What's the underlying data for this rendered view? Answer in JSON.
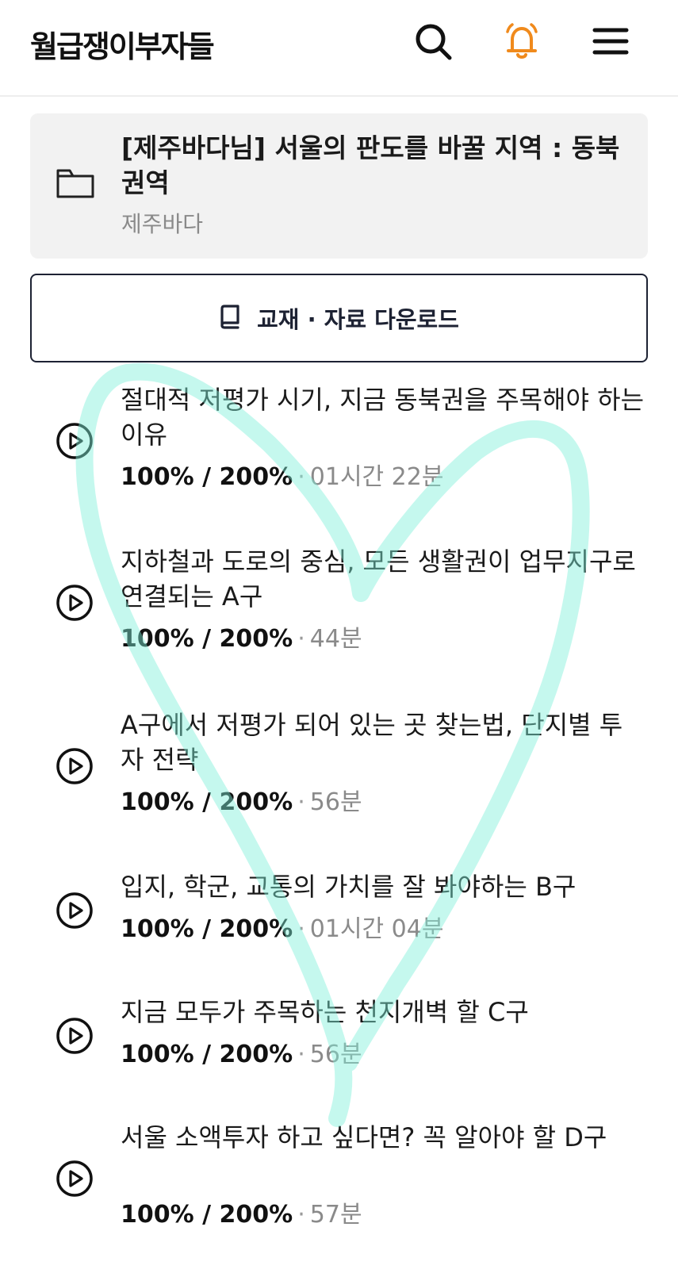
{
  "header": {
    "brand": "월급쟁이부자들",
    "search_icon": "search-icon",
    "bell_icon": "bell-icon",
    "menu_icon": "menu-icon",
    "bell_color": "#f08a1c"
  },
  "course": {
    "title": "[제주바다님] 서울의 판도를 바꿀 지역 : 동북권역",
    "author": "제주바다",
    "icon": "folder-icon"
  },
  "download": {
    "label": "교재 · 자료 다운로드",
    "icon": "book-icon"
  },
  "lessons": [
    {
      "title": "절대적 저평가 시기, 지금 동북권을 주목해야 하는 이유",
      "progress": "100% / 200%",
      "duration": "01시간 22분"
    },
    {
      "title": "지하철과 도로의 중심, 모든 생활권이 업무지구로 연결되는 A구",
      "progress": "100% / 200%",
      "duration": "44분"
    },
    {
      "title": "A구에서 저평가 되어 있는 곳 찾는법, 단지별 투자 전략",
      "progress": "100% / 200%",
      "duration": "56분"
    },
    {
      "title": "입지, 학군, 교통의 가치를 잘 봐야하는 B구",
      "progress": "100% / 200%",
      "duration": "01시간 04분"
    },
    {
      "title": "지금 모두가 주목하는 천지개벽 할 C구",
      "progress": "100% / 200%",
      "duration": "56분"
    },
    {
      "title": "서울 소액투자 하고 싶다면? 꼭 알아야 할 D구",
      "progress": "100% / 200%",
      "duration": "57분"
    }
  ],
  "overlay": {
    "drawing": "heart",
    "color": "#7ff0da"
  }
}
